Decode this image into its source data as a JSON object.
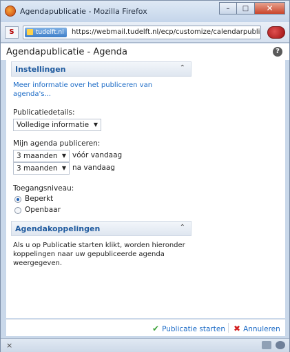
{
  "window": {
    "title": "Agendapublicatie - Mozilla Firefox",
    "controls": {
      "minimize": "–",
      "maximize": "□",
      "close": "✕"
    }
  },
  "browser": {
    "site_icon_text": "S",
    "identity_label": "tudelft.nl",
    "url": "https://webmail.tudelft.nl/ecp/customize/calendarpublis",
    "bookmark_icon": "☆"
  },
  "page": {
    "title": "Agendapublicatie - Agenda",
    "help_icon": "?"
  },
  "settings_section": {
    "title": "Instellingen",
    "collapse_icon": "⌃",
    "info_link": "Meer informatie over het publiceren van agenda's...",
    "details_label": "Publicatiedetails:",
    "details_value": "Volledige informatie",
    "publish_label": "Mijn agenda publiceren:",
    "before_value": "3 maanden",
    "before_suffix": "vóór vandaag",
    "after_value": "3 maanden",
    "after_suffix": "na vandaag",
    "access_label": "Toegangsniveau:",
    "access_options": [
      {
        "label": "Beperkt",
        "checked": true
      },
      {
        "label": "Openbaar",
        "checked": false
      }
    ]
  },
  "links_section": {
    "title": "Agendakoppelingen",
    "collapse_icon": "⌃",
    "description": "Als u op Publicatie starten klikt, worden hieronder koppelingen naar uw gepubliceerde agenda weergegeven."
  },
  "footer": {
    "start_label": "Publicatie starten",
    "cancel_label": "Annuleren",
    "check_icon": "✔",
    "x_icon": "✖"
  },
  "statusbar": {
    "close_glyph": "×"
  },
  "colors": {
    "link": "#1c6bc6",
    "section_title": "#1f5a9e",
    "check": "#3ea33a",
    "cancel_x": "#d32020"
  }
}
